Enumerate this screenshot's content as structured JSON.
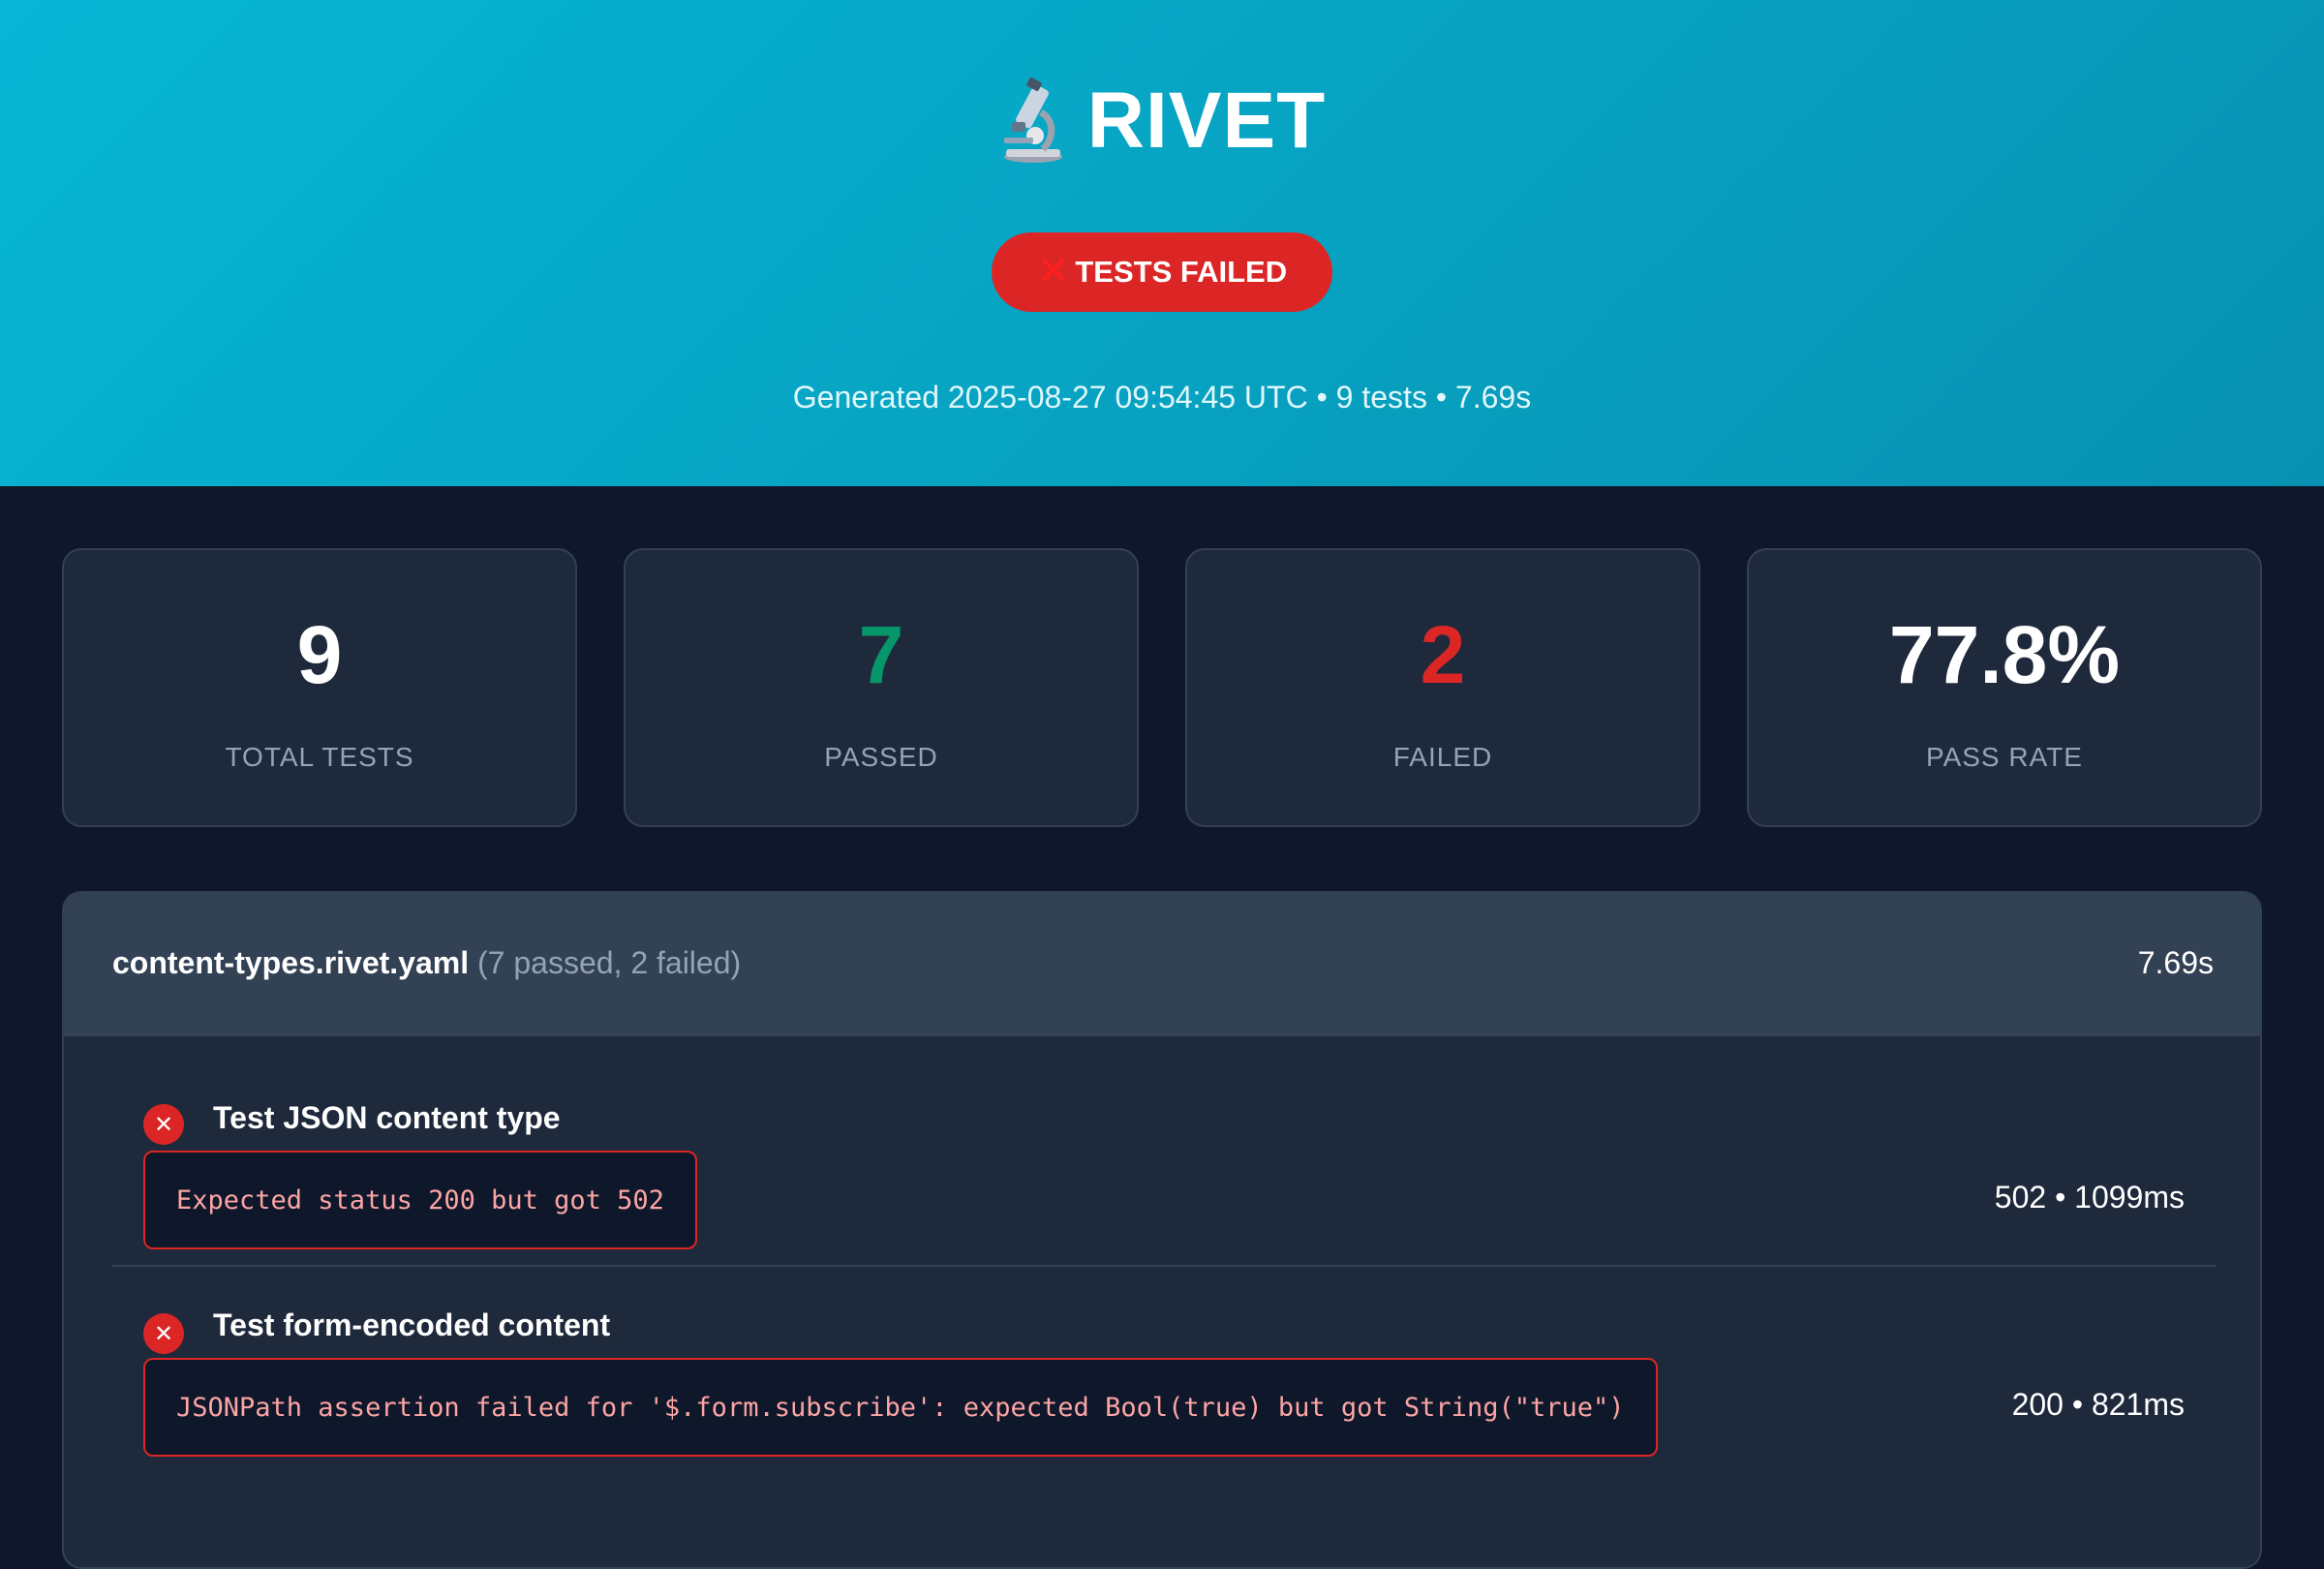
{
  "header": {
    "icon": "microscope-icon",
    "title": "RIVET",
    "status_badge": "TESTS FAILED",
    "meta": "Generated 2025-08-27 09:54:45 UTC • 9 tests • 7.69s"
  },
  "stats": [
    {
      "value": "9",
      "label": "TOTAL TESTS",
      "color": "#ffffff"
    },
    {
      "value": "7",
      "label": "PASSED",
      "color": "#059669"
    },
    {
      "value": "2",
      "label": "FAILED",
      "color": "#dc2626"
    },
    {
      "value": "77.8%",
      "label": "PASS RATE",
      "color": "#ffffff"
    }
  ],
  "suite": {
    "name": "content-types.rivet.yaml",
    "counts": "(7 passed, 2 failed)",
    "duration": "7.69s",
    "tests": [
      {
        "status": "failed",
        "name": "Test JSON content type",
        "error": "Expected status 200 but got 502",
        "meta": "502 • 1099ms"
      },
      {
        "status": "failed",
        "name": "Test form-encoded content",
        "error": "JSONPath assertion failed for '$.form.subscribe': expected Bool(true) but got String(\"true\")",
        "meta": "200 • 821ms"
      }
    ]
  },
  "colors": {
    "hero_start": "#06b6d4",
    "hero_end": "#0891b2",
    "background": "#0f172a",
    "card": "#1e293b",
    "fail": "#dc2626",
    "pass": "#059669"
  }
}
